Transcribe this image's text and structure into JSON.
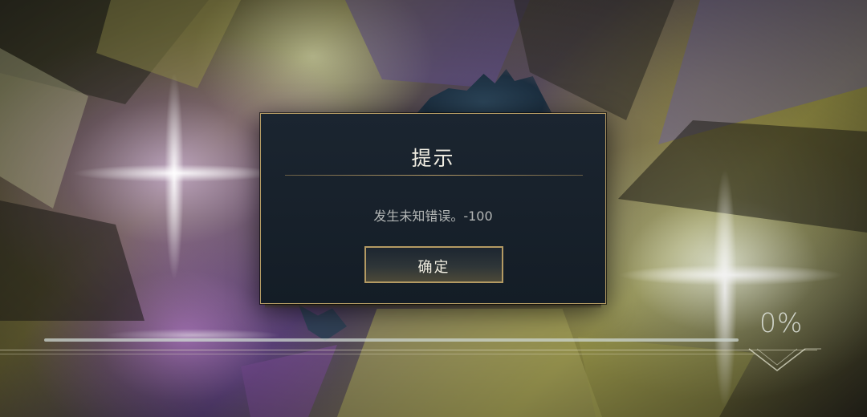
{
  "dialog": {
    "title": "提示",
    "message": "发生未知错误。-100",
    "confirm_label": "确定"
  },
  "loading": {
    "percent_text": "0%",
    "progress": 0
  },
  "colors": {
    "dialog_background": "#17202a",
    "dialog_border": "#b39a64",
    "title_text": "#f0ede2",
    "message_text": "#b4b7b6",
    "button_border": "#b49a63"
  }
}
